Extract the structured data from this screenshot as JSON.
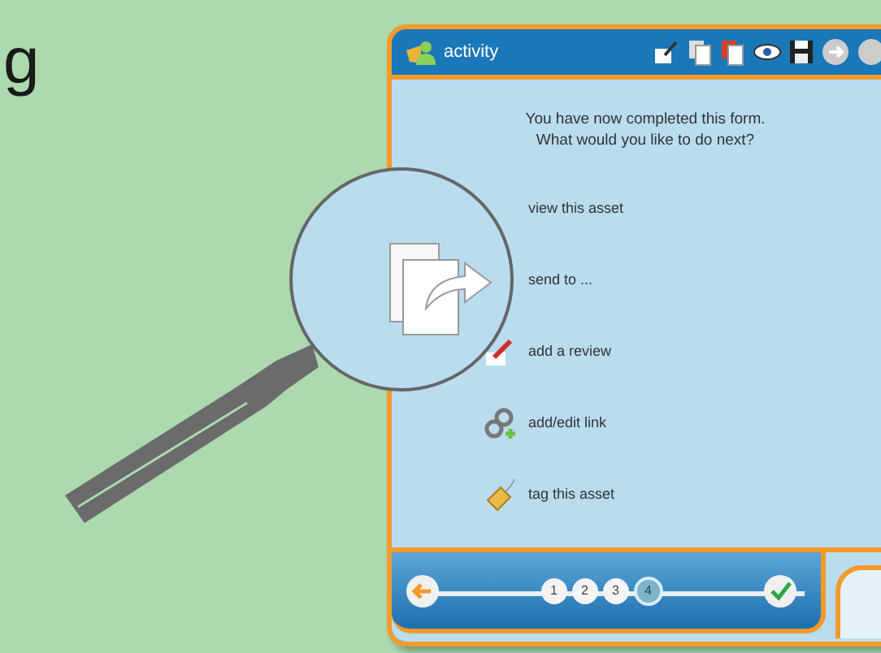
{
  "heading_fragment": "g",
  "window": {
    "title": "activity"
  },
  "message": [
    "You have now completed this form.",
    "What would you like to do next?"
  ],
  "actions": [
    {
      "label": "view this asset"
    },
    {
      "label": "send to ..."
    },
    {
      "label": "add a review"
    },
    {
      "label": "add/edit link"
    },
    {
      "label": "tag this asset"
    }
  ],
  "steps": [
    {
      "label": "1",
      "selected": false
    },
    {
      "label": "2",
      "selected": false
    },
    {
      "label": "3",
      "selected": false
    },
    {
      "label": "4",
      "selected": true
    }
  ]
}
